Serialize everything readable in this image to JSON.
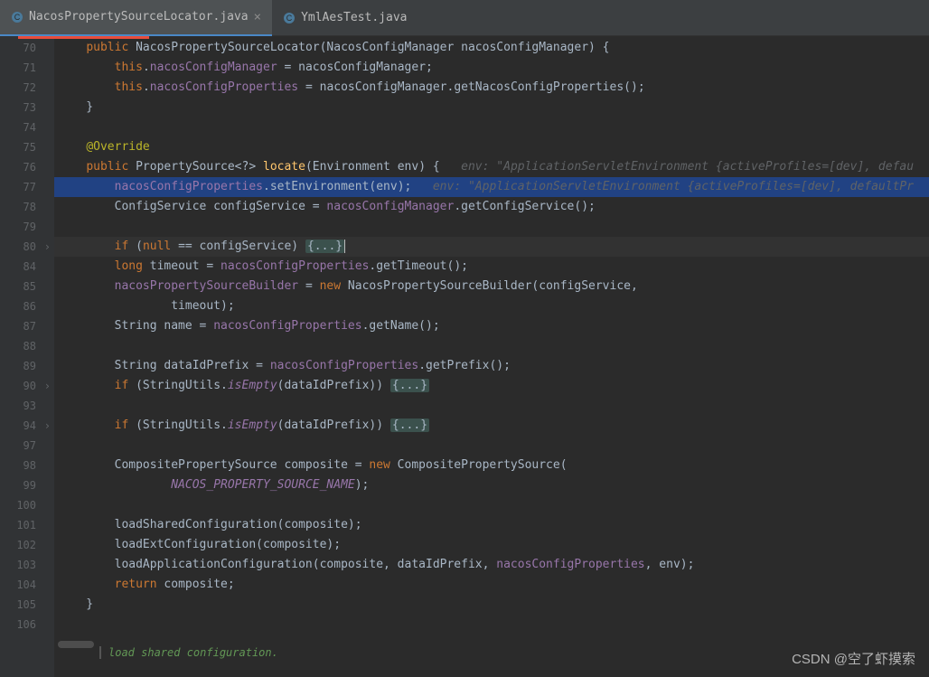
{
  "tabs": {
    "active": {
      "name": "NacosPropertySourceLocator.java",
      "close": "×"
    },
    "other": {
      "name": "YmlAesTest.java"
    }
  },
  "gutter": {
    "lines": [
      "70",
      "71",
      "72",
      "73",
      "74",
      "75",
      "76",
      "77",
      "78",
      "79",
      "80",
      "84",
      "85",
      "86",
      "87",
      "88",
      "89",
      "90",
      "93",
      "94",
      "97",
      "98",
      "99",
      "100",
      "101",
      "102",
      "103",
      "104",
      "105",
      "106"
    ],
    "folds": [
      10,
      17,
      19
    ],
    "marker_line": 6
  },
  "code": {
    "l70a": "    ",
    "l70_kw": "public",
    "l70b": " NacosPropertySourceLocator(NacosConfigManager nacosConfigManager) {",
    "l71a": "        ",
    "l71_kw": "this",
    "l71b": ".",
    "l71_f": "nacosConfigManager",
    "l71c": " = nacosConfigManager;",
    "l72a": "        ",
    "l72_kw": "this",
    "l72b": ".",
    "l72_f": "nacosConfigProperties",
    "l72c": " = nacosConfigManager.getNacosConfigProperties();",
    "l73": "    }",
    "l74": "",
    "l75a": "    ",
    "l75_ann": "@Override",
    "l76a": "    ",
    "l76_kw": "public",
    "l76b": " PropertySource<?> ",
    "l76_m": "locate",
    "l76c": "(Environment env) {   ",
    "l76_h": "env: \"ApplicationServletEnvironment {activeProfiles=[dev], defau",
    "l77a": "        ",
    "l77_f": "nacosConfigProperties",
    "l77b": ".setEnvironment(env);   ",
    "l77_h": "env: \"ApplicationServletEnvironment {activeProfiles=[dev], defaultPr",
    "l78a": "        ConfigService configService = ",
    "l78_f": "nacosConfigManager",
    "l78b": ".getConfigService();",
    "l79": "",
    "l80a": "        ",
    "l80_kw": "if",
    "l80b": " (",
    "l80_kw2": "null",
    "l80c": " == configService) ",
    "l80_fold": "{...}",
    "l84a": "        ",
    "l84_kw": "long",
    "l84b": " timeout = ",
    "l84_f": "nacosConfigProperties",
    "l84c": ".getTimeout();",
    "l85a": "        ",
    "l85_f": "nacosPropertySourceBuilder",
    "l85b": " = ",
    "l85_kw": "new",
    "l85c": " NacosPropertySourceBuilder(configService,",
    "l86a": "                timeout);",
    "l87a": "        String name = ",
    "l87_f": "nacosConfigProperties",
    "l87b": ".getName();",
    "l88": "",
    "l89a": "        String dataIdPrefix = ",
    "l89_f": "nacosConfigProperties",
    "l89b": ".getPrefix();",
    "l90a": "        ",
    "l90_kw": "if",
    "l90b": " (StringUtils.",
    "l90_m": "isEmpty",
    "l90c": "(dataIdPrefix)) ",
    "l90_fold": "{...}",
    "l93": "",
    "l94a": "        ",
    "l94_kw": "if",
    "l94b": " (StringUtils.",
    "l94_m": "isEmpty",
    "l94c": "(dataIdPrefix)) ",
    "l94_fold": "{...}",
    "l97": "",
    "l98a": "        CompositePropertySource composite = ",
    "l98_kw": "new",
    "l98b": " CompositePropertySource(",
    "l99a": "                ",
    "l99_sf": "NACOS_PROPERTY_SOURCE_NAME",
    "l99b": ");",
    "l100": "",
    "l101a": "        loadSharedConfiguration(composite);",
    "l102a": "        loadExtConfiguration(composite);",
    "l103a": "        loadApplicationConfiguration(composite, dataIdPrefix, ",
    "l103_f": "nacosConfigProperties",
    "l103b": ", env);",
    "l104a": "        ",
    "l104_kw": "return",
    "l104b": " composite;",
    "l105": "    }",
    "l106": ""
  },
  "doc_hint": "load shared configuration.",
  "watermark": "CSDN @空了虾摸索"
}
